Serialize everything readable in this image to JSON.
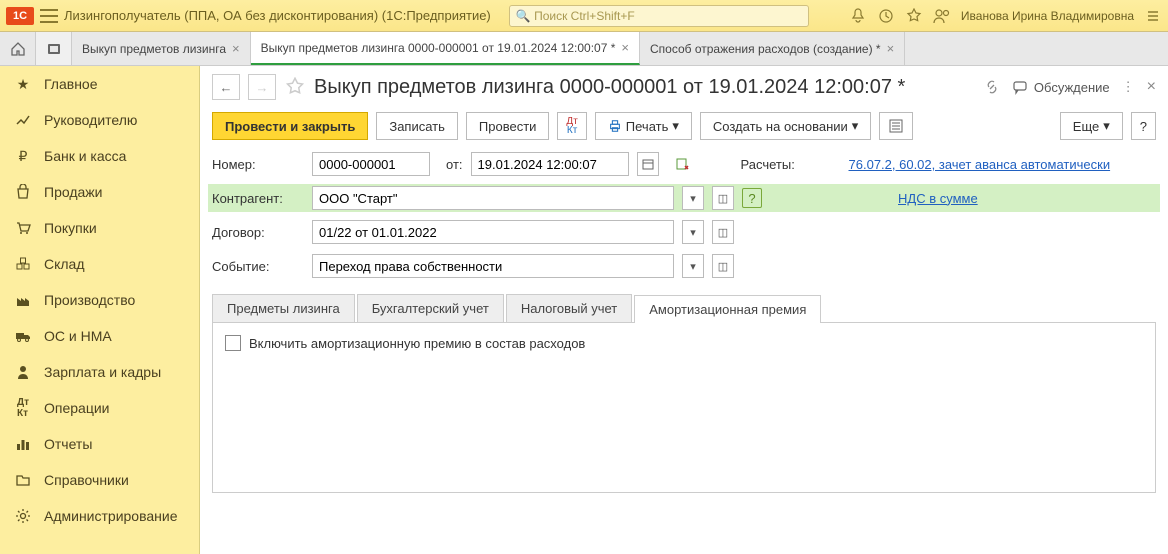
{
  "titlebar": {
    "app_title": "Лизингополучатель (ППА, ОА без дисконтирования)  (1С:Предприятие)",
    "search_placeholder": "Поиск Ctrl+Shift+F",
    "user": "Иванова Ирина Владимировна"
  },
  "tabs": {
    "t1": "Выкуп предметов лизинга",
    "t2": "Выкуп предметов лизинга 0000-000001 от 19.01.2024 12:00:07 *",
    "t3": "Способ отражения расходов (создание) *"
  },
  "sidebar": {
    "items": [
      "Главное",
      "Руководителю",
      "Банк и касса",
      "Продажи",
      "Покупки",
      "Склад",
      "Производство",
      "ОС и НМА",
      "Зарплата и кадры",
      "Операции",
      "Отчеты",
      "Справочники",
      "Администрирование"
    ]
  },
  "doc": {
    "title": "Выкуп предметов лизинга 0000-000001 от 19.01.2024 12:00:07 *",
    "discuss": "Обсуждение"
  },
  "toolbar": {
    "post_close": "Провести и закрыть",
    "save": "Записать",
    "post": "Провести",
    "print": "Печать",
    "create_based": "Создать на основании",
    "more": "Еще",
    "help": "?"
  },
  "form": {
    "number_label": "Номер:",
    "number_value": "0000-000001",
    "from_label": "от:",
    "date_value": "19.01.2024 12:00:07",
    "settlements_label": "Расчеты:",
    "settlements_link": "76.07.2, 60.02, зачет аванса автоматически",
    "counterparty_label": "Контрагент:",
    "counterparty_value": "ООО \"Старт\"",
    "nds_link": "НДС в сумме",
    "contract_label": "Договор:",
    "contract_value": "01/22 от 01.01.2022",
    "event_label": "Событие:",
    "event_value": "Переход права собственности"
  },
  "tabs2": {
    "t0": "Предметы лизинга",
    "t1": "Бухгалтерский учет",
    "t2": "Налоговый учет",
    "t3": "Амортизационная премия"
  },
  "panel": {
    "checkbox_label": "Включить амортизационную премию в состав расходов"
  }
}
